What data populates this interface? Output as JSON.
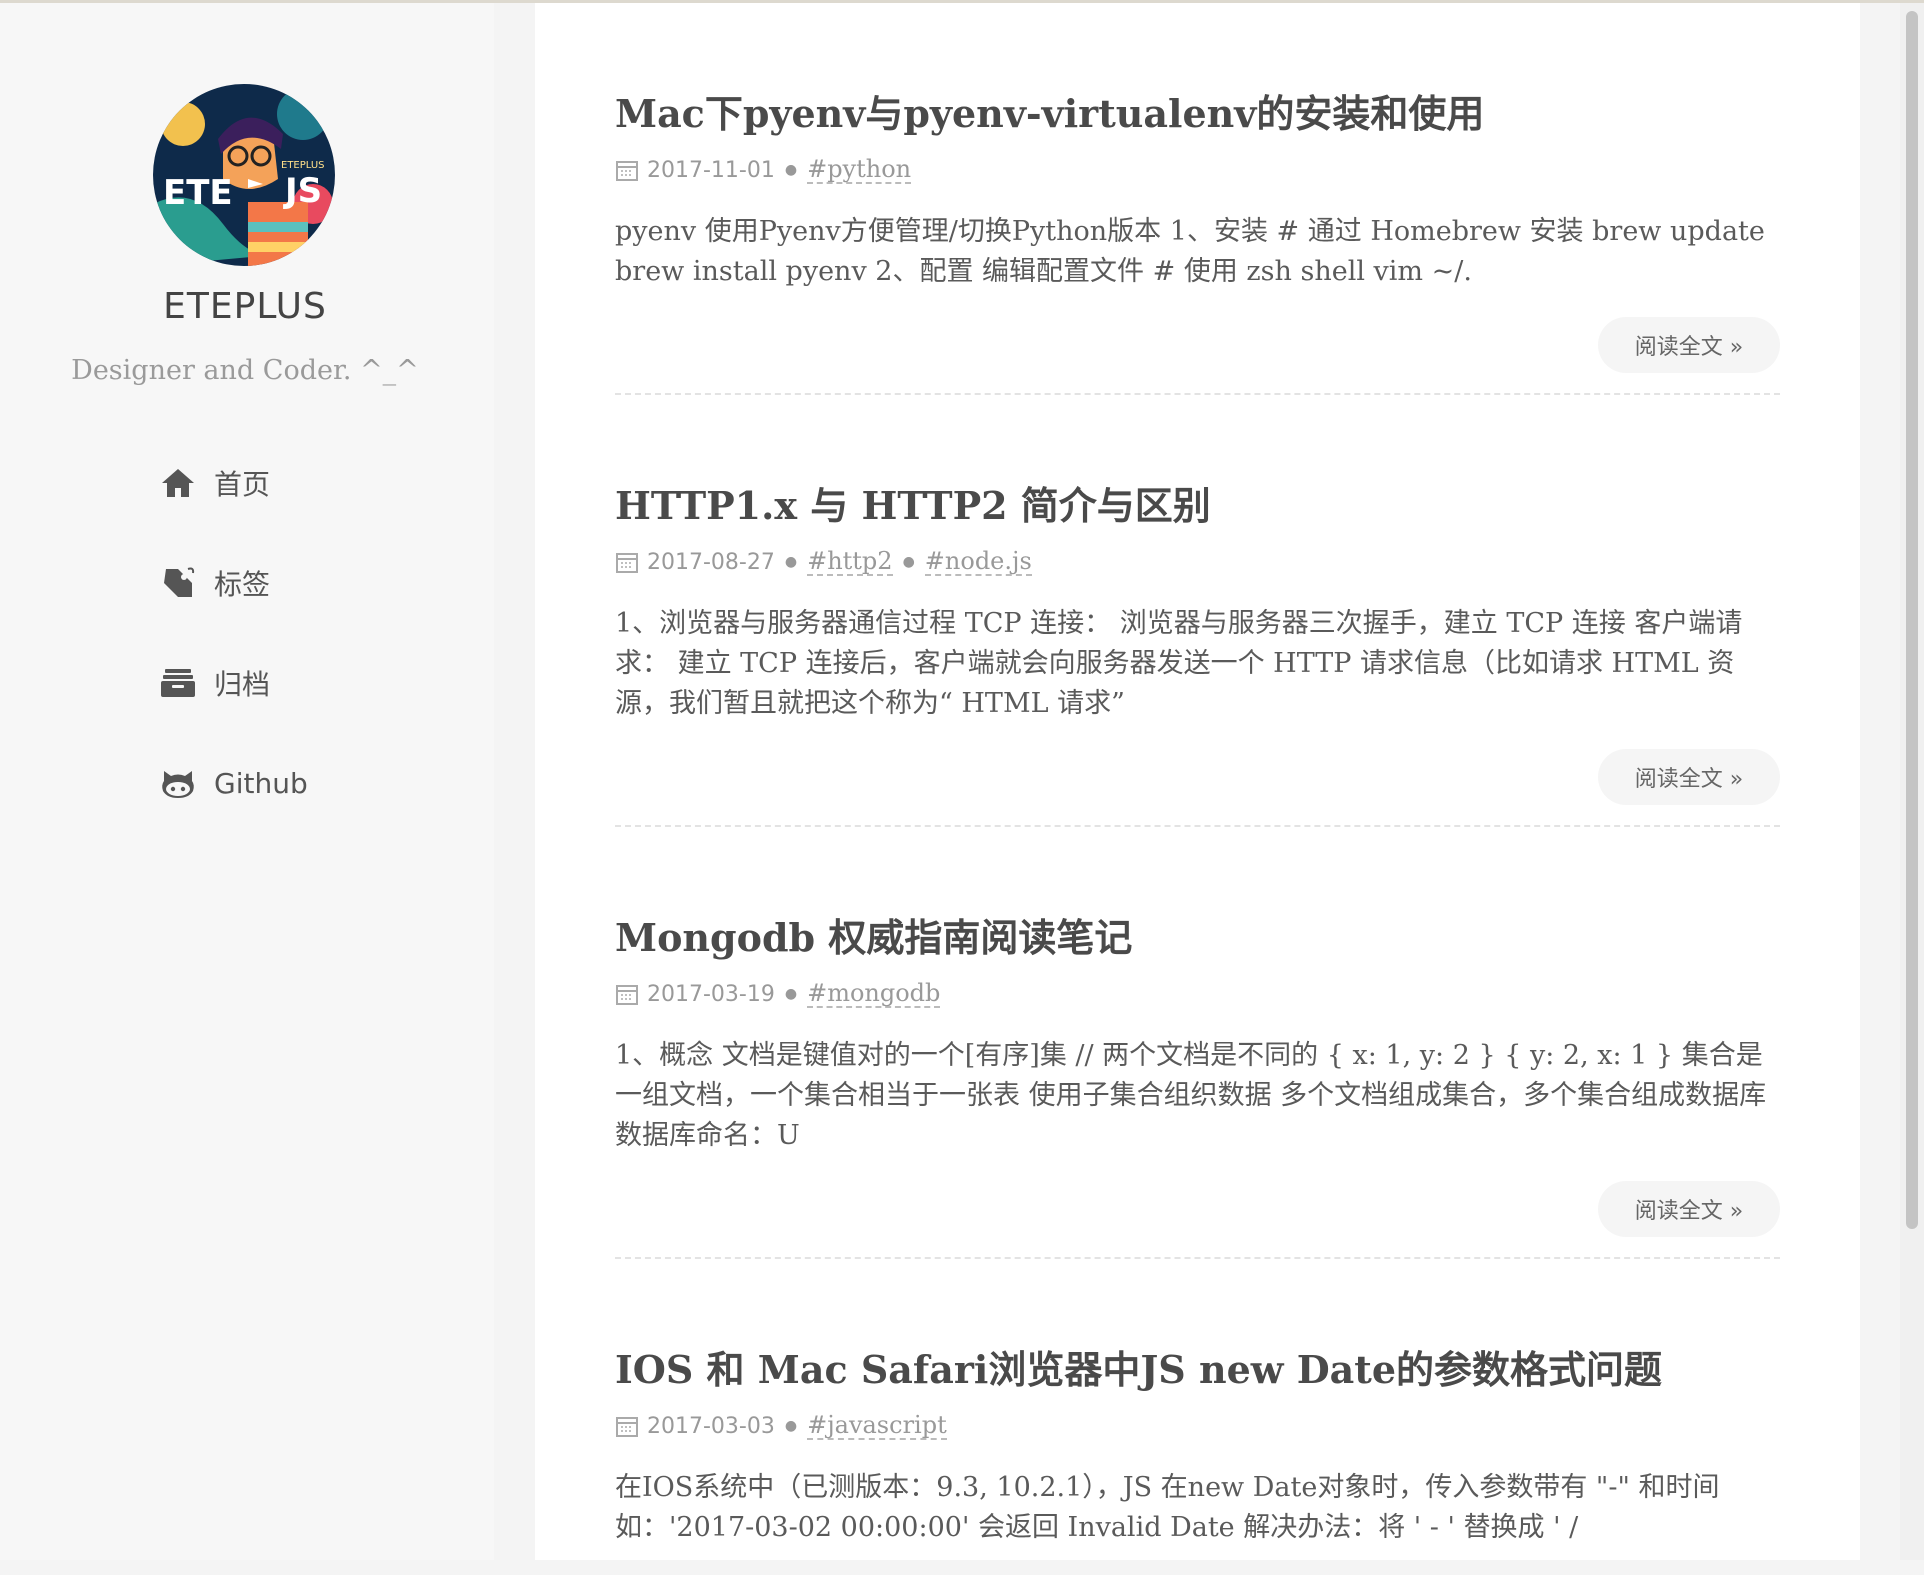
{
  "sidebar": {
    "title": "ETEPLUS",
    "subtitle": "Designer and Coder. ^_^",
    "nav": [
      {
        "label": "首页",
        "icon": "home-icon"
      },
      {
        "label": "标签",
        "icon": "tag-icon"
      },
      {
        "label": "归档",
        "icon": "archive-icon"
      },
      {
        "label": "Github",
        "icon": "github-icon"
      }
    ]
  },
  "posts": [
    {
      "title": "Mac下pyenv与pyenv-virtualenv的安装和使用",
      "date": "2017-11-01",
      "tags": [
        "#python"
      ],
      "excerpt": "pyenv 使用Pyenv方便管理/切换Python版本 1、安装 # 通过 Homebrew 安装 brew update brew install pyenv 2、配置 编辑配置文件 # 使用 zsh shell vim ~/.",
      "read_more": "阅读全文 »"
    },
    {
      "title": "HTTP1.x 与 HTTP2 简介与区别",
      "date": "2017-08-27",
      "tags": [
        "#http2",
        "#node.js"
      ],
      "excerpt": "1、浏览器与服务器通信过程 TCP 连接： 浏览器与服务器三次握手，建立 TCP 连接 客户端请求： 建立 TCP 连接后，客户端就会向服务器发送一个 HTTP 请求信息（比如请求 HTML 资源，我们暂且就把这个称为“ HTML 请求”",
      "read_more": "阅读全文 »"
    },
    {
      "title": "Mongodb 权威指南阅读笔记",
      "date": "2017-03-19",
      "tags": [
        "#mongodb"
      ],
      "excerpt": "1、概念 文档是键值对的一个[有序]集 // 两个文档是不同的 { x: 1, y: 2 } { y: 2, x: 1 } 集合是一组文档，一个集合相当于一张表 使用子集合组织数据 多个文档组成集合，多个集合组成数据库 数据库命名：U",
      "read_more": "阅读全文 »"
    },
    {
      "title": "IOS 和 Mac Safari浏览器中JS new Date的参数格式问题",
      "date": "2017-03-03",
      "tags": [
        "#javascript"
      ],
      "excerpt": "在IOS系统中（已测版本：9.3, 10.2.1），JS 在new Date对象时，传入参数带有 \"-\" 和时间如：'2017-03-02 00:00:00' 会返回 Invalid Date 解决办法：将 ' - ' 替换成 ' /",
      "read_more": ""
    }
  ]
}
